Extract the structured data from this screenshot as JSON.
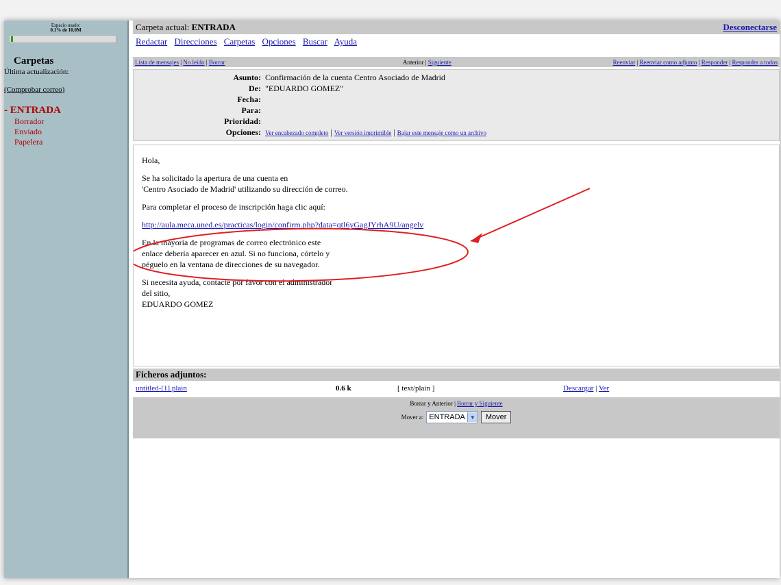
{
  "sidebar": {
    "quota_line1": "Espacio usado:",
    "quota_line2": "0.1% de 10.0M",
    "quota_percent": 0.1,
    "folders_title": "Carpetas",
    "last_update": "Última actualización:",
    "check_mail": "(Comprobar correo)",
    "current_folder": "- ENTRADA",
    "folders": [
      "Borrador",
      "Enviado",
      "Papelera"
    ]
  },
  "topbar": {
    "current_folder_label": "Carpeta actual: ",
    "current_folder_name": "ENTRADA",
    "logout": "Desconectarse"
  },
  "menu": [
    "Redactar",
    "Direcciones",
    "Carpetas",
    "Opciones",
    "Buscar",
    "Ayuda"
  ],
  "navbar": {
    "left": [
      "Lista de mensajes",
      "No leído",
      "Borrar"
    ],
    "prev": "Anterior",
    "next": "Siguiente",
    "right": [
      "Reenviar",
      "Reenviar como adjunto",
      "Responder",
      "Responder a todos"
    ]
  },
  "headers": {
    "labels": {
      "subject": "Asunto:",
      "from": "De:",
      "date": "Fecha:",
      "to": "Para:",
      "priority": "Prioridad:",
      "options": "Opciones:"
    },
    "subject": "Confirmación de la cuenta Centro Asociado de Madrid",
    "from": "\"EDUARDO GOMEZ\"",
    "date": "",
    "to": "",
    "priority": "",
    "options": [
      "Ver encabezado completo",
      "Ver versión imprimible",
      "Bajar este mensaje como un archivo"
    ]
  },
  "message": {
    "greeting": "Hola,",
    "p1_line1": "Se ha solicitado la apertura de una cuenta en",
    "p1_line2": "'Centro Asociado de Madrid' utilizando su dirección de correo.",
    "p2": "Para completar el proceso de inscripción haga clic aquí:",
    "link": "http://aula.meca.uned.es/practicas/login/confirm.php?data=qtl6yGagJYrhA9U/angelv",
    "p3_line1": "En la mayoría de programas de correo electrónico este",
    "p3_line2": "enlace debería aparecer en azul. Si no funciona, córtelo y",
    "p3_line3": "péguelo en la ventana de direcciones de su navegador.",
    "p4_line1": "Si necesita ayuda, contacte por favor con el administrador",
    "p4_line2": "del sitio,",
    "p4_line3": "EDUARDO GOMEZ"
  },
  "attachments": {
    "title": "Ficheros adjuntos:",
    "name": "untitled-[1].plain",
    "size": "0.6 k",
    "type": "[ text/plain ]",
    "download": "Descargar",
    "view": "Ver"
  },
  "bottom": {
    "delete_prev": "Borrar y Anterior",
    "delete_next": "Borrar y Siguiente",
    "move_to": "Mover a:",
    "move_selected": "ENTRADA",
    "move_button": "Mover"
  },
  "colors": {
    "sidebar_bg": "#a8bfc6",
    "bar_bg": "#c8c8c8",
    "folder_red": "#b00000",
    "link_blue": "#1a1ab0",
    "annotation_red": "#e02020"
  }
}
